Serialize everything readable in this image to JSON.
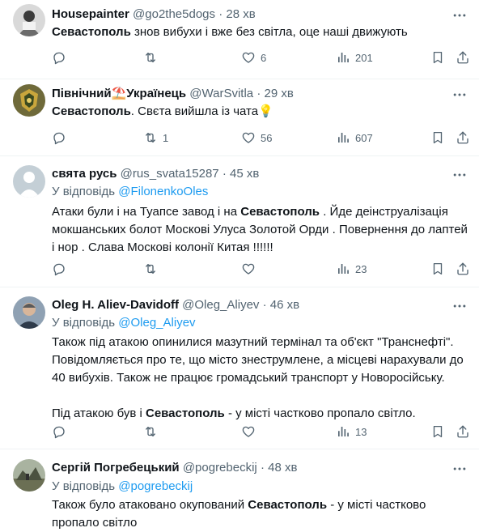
{
  "tweets": [
    {
      "name": "Housepainter",
      "handle": "@go2the5dogs",
      "time": "28 хв",
      "reply_prefix": "",
      "reply_handle": "",
      "body": [
        {
          "b": "Севастополь"
        },
        {
          "t": " знов вибухи і вже без світла, оце наші движують"
        }
      ],
      "replies": "",
      "retweets": "",
      "likes": "6",
      "views": "201"
    },
    {
      "name": "Північний⛱️Українець",
      "handle": "@WarSvitla",
      "time": "29 хв",
      "reply_prefix": "",
      "reply_handle": "",
      "body": [
        {
          "b": "Севастополь"
        },
        {
          "t": ". Свєта вийшла із чата💡"
        }
      ],
      "replies": "",
      "retweets": "1",
      "likes": "56",
      "views": "607"
    },
    {
      "name": "свята русь",
      "handle": "@rus_svata15287",
      "time": "45 хв",
      "reply_prefix": "У відповідь ",
      "reply_handle": "@FilonenkoOles",
      "body": [
        {
          "t": "Атаки були і на Туапсе завод і на "
        },
        {
          "b": "Севастополь"
        },
        {
          "t": " . Йде деінструалізація мокшанських болот Москові Улуса Золотой Орди . Повернення до лаптей і  нор . Слава Москові колонії Китая !!!!!!"
        }
      ],
      "replies": "",
      "retweets": "",
      "likes": "",
      "views": "23"
    },
    {
      "name": "Oleg H. Aliev-Davidoff",
      "handle": "@Oleg_Aliyev",
      "time": "46 хв",
      "reply_prefix": "У відповідь ",
      "reply_handle": "@Oleg_Aliyev",
      "body": [
        {
          "t": "Також під атакою опинилися мазутний термінал та об'єкт \"Транснефті\". Повідомляється про те, що місто знеструмлене, а місцеві нарахували до 40 вибухів. Також не працює громадський транспорт у Новоросійську.\n\nПід атакою був і "
        },
        {
          "b": "Севастополь"
        },
        {
          "t": " - у місті частково пропало світло."
        }
      ],
      "replies": "",
      "retweets": "",
      "likes": "",
      "views": "13"
    },
    {
      "name": "Сергій Погребецький",
      "handle": "@pogrebeckij",
      "time": "48 хв",
      "reply_prefix": "У відповідь ",
      "reply_handle": "@pogrebeckij",
      "body": [
        {
          "t": "Також було атаковано окупований "
        },
        {
          "b": "Севастополь"
        },
        {
          "t": " - у місті частково пропало світло"
        }
      ],
      "replies": "",
      "retweets": "",
      "likes": "",
      "views": ""
    }
  ],
  "icons": {
    "reply": "reply-icon",
    "retweet": "retweet-icon",
    "like": "like-icon",
    "views": "views-icon",
    "bookmark": "bookmark-icon",
    "share": "share-icon",
    "more": "more-icon"
  },
  "colors": {
    "text": "#0f1419",
    "muted": "#536471",
    "link": "#1d9bf0",
    "divider": "#eff3f4"
  }
}
